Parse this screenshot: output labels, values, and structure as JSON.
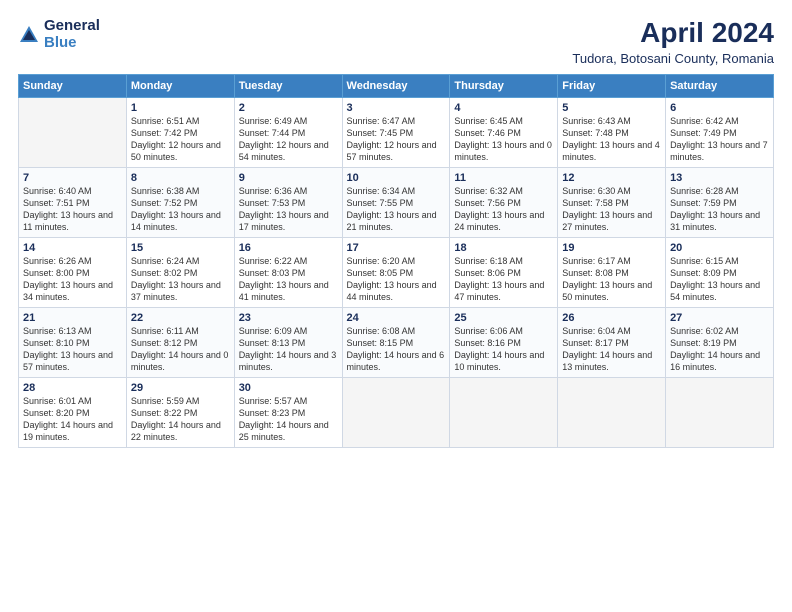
{
  "logo": {
    "general": "General",
    "blue": "Blue"
  },
  "title": "April 2024",
  "subtitle": "Tudora, Botosani County, Romania",
  "days_header": [
    "Sunday",
    "Monday",
    "Tuesday",
    "Wednesday",
    "Thursday",
    "Friday",
    "Saturday"
  ],
  "weeks": [
    [
      {
        "num": "",
        "empty": true
      },
      {
        "num": "1",
        "sunrise": "Sunrise: 6:51 AM",
        "sunset": "Sunset: 7:42 PM",
        "daylight": "Daylight: 12 hours and 50 minutes."
      },
      {
        "num": "2",
        "sunrise": "Sunrise: 6:49 AM",
        "sunset": "Sunset: 7:44 PM",
        "daylight": "Daylight: 12 hours and 54 minutes."
      },
      {
        "num": "3",
        "sunrise": "Sunrise: 6:47 AM",
        "sunset": "Sunset: 7:45 PM",
        "daylight": "Daylight: 12 hours and 57 minutes."
      },
      {
        "num": "4",
        "sunrise": "Sunrise: 6:45 AM",
        "sunset": "Sunset: 7:46 PM",
        "daylight": "Daylight: 13 hours and 0 minutes."
      },
      {
        "num": "5",
        "sunrise": "Sunrise: 6:43 AM",
        "sunset": "Sunset: 7:48 PM",
        "daylight": "Daylight: 13 hours and 4 minutes."
      },
      {
        "num": "6",
        "sunrise": "Sunrise: 6:42 AM",
        "sunset": "Sunset: 7:49 PM",
        "daylight": "Daylight: 13 hours and 7 minutes."
      }
    ],
    [
      {
        "num": "7",
        "sunrise": "Sunrise: 6:40 AM",
        "sunset": "Sunset: 7:51 PM",
        "daylight": "Daylight: 13 hours and 11 minutes."
      },
      {
        "num": "8",
        "sunrise": "Sunrise: 6:38 AM",
        "sunset": "Sunset: 7:52 PM",
        "daylight": "Daylight: 13 hours and 14 minutes."
      },
      {
        "num": "9",
        "sunrise": "Sunrise: 6:36 AM",
        "sunset": "Sunset: 7:53 PM",
        "daylight": "Daylight: 13 hours and 17 minutes."
      },
      {
        "num": "10",
        "sunrise": "Sunrise: 6:34 AM",
        "sunset": "Sunset: 7:55 PM",
        "daylight": "Daylight: 13 hours and 21 minutes."
      },
      {
        "num": "11",
        "sunrise": "Sunrise: 6:32 AM",
        "sunset": "Sunset: 7:56 PM",
        "daylight": "Daylight: 13 hours and 24 minutes."
      },
      {
        "num": "12",
        "sunrise": "Sunrise: 6:30 AM",
        "sunset": "Sunset: 7:58 PM",
        "daylight": "Daylight: 13 hours and 27 minutes."
      },
      {
        "num": "13",
        "sunrise": "Sunrise: 6:28 AM",
        "sunset": "Sunset: 7:59 PM",
        "daylight": "Daylight: 13 hours and 31 minutes."
      }
    ],
    [
      {
        "num": "14",
        "sunrise": "Sunrise: 6:26 AM",
        "sunset": "Sunset: 8:00 PM",
        "daylight": "Daylight: 13 hours and 34 minutes."
      },
      {
        "num": "15",
        "sunrise": "Sunrise: 6:24 AM",
        "sunset": "Sunset: 8:02 PM",
        "daylight": "Daylight: 13 hours and 37 minutes."
      },
      {
        "num": "16",
        "sunrise": "Sunrise: 6:22 AM",
        "sunset": "Sunset: 8:03 PM",
        "daylight": "Daylight: 13 hours and 41 minutes."
      },
      {
        "num": "17",
        "sunrise": "Sunrise: 6:20 AM",
        "sunset": "Sunset: 8:05 PM",
        "daylight": "Daylight: 13 hours and 44 minutes."
      },
      {
        "num": "18",
        "sunrise": "Sunrise: 6:18 AM",
        "sunset": "Sunset: 8:06 PM",
        "daylight": "Daylight: 13 hours and 47 minutes."
      },
      {
        "num": "19",
        "sunrise": "Sunrise: 6:17 AM",
        "sunset": "Sunset: 8:08 PM",
        "daylight": "Daylight: 13 hours and 50 minutes."
      },
      {
        "num": "20",
        "sunrise": "Sunrise: 6:15 AM",
        "sunset": "Sunset: 8:09 PM",
        "daylight": "Daylight: 13 hours and 54 minutes."
      }
    ],
    [
      {
        "num": "21",
        "sunrise": "Sunrise: 6:13 AM",
        "sunset": "Sunset: 8:10 PM",
        "daylight": "Daylight: 13 hours and 57 minutes."
      },
      {
        "num": "22",
        "sunrise": "Sunrise: 6:11 AM",
        "sunset": "Sunset: 8:12 PM",
        "daylight": "Daylight: 14 hours and 0 minutes."
      },
      {
        "num": "23",
        "sunrise": "Sunrise: 6:09 AM",
        "sunset": "Sunset: 8:13 PM",
        "daylight": "Daylight: 14 hours and 3 minutes."
      },
      {
        "num": "24",
        "sunrise": "Sunrise: 6:08 AM",
        "sunset": "Sunset: 8:15 PM",
        "daylight": "Daylight: 14 hours and 6 minutes."
      },
      {
        "num": "25",
        "sunrise": "Sunrise: 6:06 AM",
        "sunset": "Sunset: 8:16 PM",
        "daylight": "Daylight: 14 hours and 10 minutes."
      },
      {
        "num": "26",
        "sunrise": "Sunrise: 6:04 AM",
        "sunset": "Sunset: 8:17 PM",
        "daylight": "Daylight: 14 hours and 13 minutes."
      },
      {
        "num": "27",
        "sunrise": "Sunrise: 6:02 AM",
        "sunset": "Sunset: 8:19 PM",
        "daylight": "Daylight: 14 hours and 16 minutes."
      }
    ],
    [
      {
        "num": "28",
        "sunrise": "Sunrise: 6:01 AM",
        "sunset": "Sunset: 8:20 PM",
        "daylight": "Daylight: 14 hours and 19 minutes."
      },
      {
        "num": "29",
        "sunrise": "Sunrise: 5:59 AM",
        "sunset": "Sunset: 8:22 PM",
        "daylight": "Daylight: 14 hours and 22 minutes."
      },
      {
        "num": "30",
        "sunrise": "Sunrise: 5:57 AM",
        "sunset": "Sunset: 8:23 PM",
        "daylight": "Daylight: 14 hours and 25 minutes."
      },
      {
        "num": "",
        "empty": true
      },
      {
        "num": "",
        "empty": true
      },
      {
        "num": "",
        "empty": true
      },
      {
        "num": "",
        "empty": true
      }
    ]
  ]
}
